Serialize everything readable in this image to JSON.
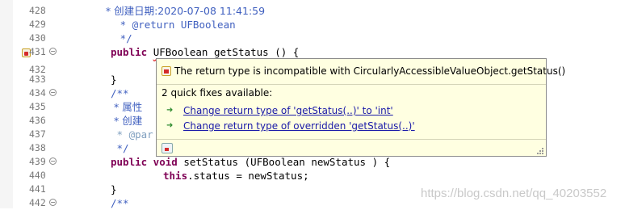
{
  "editor": {
    "lines": [
      {
        "num": "428",
        "fold": "",
        "text": "     * 创建日期:2020-07-08 11:41:59"
      },
      {
        "num": "429",
        "fold": "",
        "text": "     * @return UFBoolean"
      },
      {
        "num": "430",
        "fold": "",
        "text": "     */"
      },
      {
        "num": "431",
        "fold": "−",
        "kw": "public ",
        "type": "UFBoolean",
        "rest": " getStatus () {"
      },
      {
        "num": "432",
        "fold": "",
        "text": ""
      },
      {
        "num": "433",
        "fold": "",
        "text": "}"
      },
      {
        "num": "434",
        "fold": "−",
        "text": "/**"
      },
      {
        "num": "435",
        "fold": "",
        "text": " * 属性"
      },
      {
        "num": "436",
        "fold": "",
        "text": " * 创建"
      },
      {
        "num": "437",
        "fold": "",
        "text": " * @par"
      },
      {
        "num": "438",
        "fold": "",
        "text": " */"
      },
      {
        "num": "439",
        "fold": "−",
        "kw": "public void ",
        "rest": "setStatus (UFBoolean newStatus ) {"
      },
      {
        "num": "440",
        "fold": "",
        "kw": "this",
        "rest": ".status = newStatus;"
      },
      {
        "num": "441",
        "fold": "",
        "text": "}"
      },
      {
        "num": "442",
        "fold": "−",
        "text": "/**"
      }
    ]
  },
  "quick_fix": {
    "message": "The return type is incompatible with CircularlyAccessibleValueObject.getStatus()",
    "count_label": "2 quick fixes available:",
    "fixes": [
      "Change return type of 'getStatus(..)' to 'int'",
      "Change return type of overridden 'getStatus(..)'"
    ]
  },
  "watermark": "https://blog.csdn.net/qq_40203552",
  "colors": {
    "keyword": "#7f0055",
    "javadoc": "#3f5fbf",
    "javadoc_tag": "#7f9fbf",
    "field": "#0000c0",
    "hover_bg": "#ffffe1",
    "link": "#1a1aa8",
    "error": "#d42a2a"
  }
}
